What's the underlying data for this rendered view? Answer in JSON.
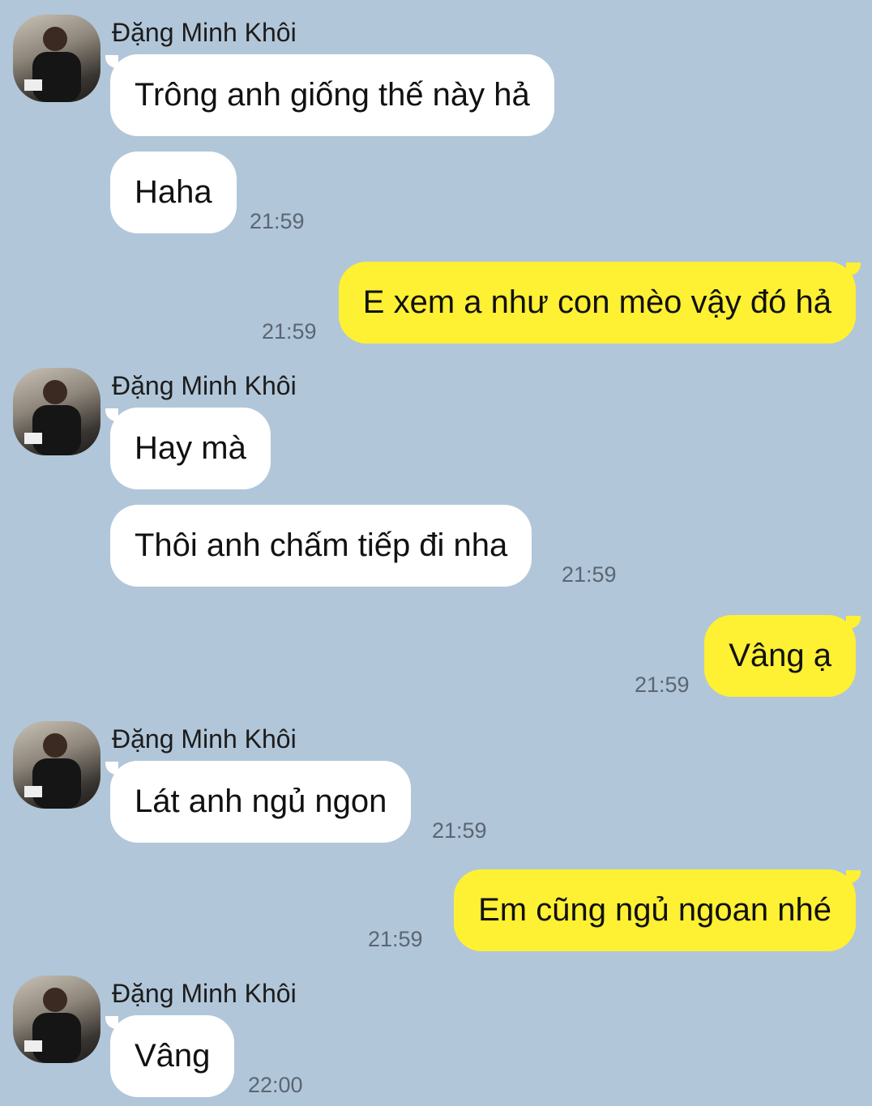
{
  "chat": {
    "contact_name": "Đặng Minh Khôi",
    "groups": [
      {
        "sender": "Đặng Minh Khôi",
        "messages": [
          "Trông anh giống thế này hả",
          "Haha"
        ],
        "time": "21:59"
      },
      {
        "outgoing": "E xem a như con mèo vậy đó hả",
        "time": "21:59"
      },
      {
        "sender": "Đặng Minh Khôi",
        "messages": [
          "Hay mà",
          "Thôi anh chấm tiếp đi nha"
        ],
        "time": "21:59"
      },
      {
        "outgoing": "Vâng ạ",
        "time": "21:59"
      },
      {
        "sender": "Đặng Minh Khôi",
        "messages": [
          "Lát anh ngủ ngon"
        ],
        "time": "21:59"
      },
      {
        "outgoing": "Em cũng ngủ ngoan nhé",
        "time": "21:59"
      },
      {
        "sender": "Đặng Minh Khôi",
        "messages": [
          "Vâng"
        ],
        "time": "22:00"
      }
    ]
  },
  "colors": {
    "background": "#b1c6d9",
    "incoming_bubble": "#ffffff",
    "outgoing_bubble": "#fef033",
    "timestamp": "#5b6673"
  }
}
